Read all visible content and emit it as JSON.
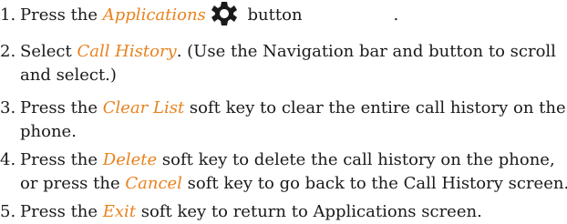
{
  "colors": {
    "text": "#1a1a1a",
    "highlight": "#e8821e"
  },
  "icons": {
    "applications_button": "gear-icon"
  },
  "steps": [
    {
      "number": "1.",
      "before": "Press the ",
      "highlight": "Applications",
      "after": " button",
      "trailing": "."
    },
    {
      "number": "2.",
      "before": "Select ",
      "highlight": "Call History",
      "after": ". (Use the Navigation bar and button to scroll",
      "continuation": "and select.)"
    },
    {
      "number": "3.",
      "before": "Press the ",
      "highlight": "Clear List",
      "after": " soft key to clear the entire call history on the",
      "continuation": "phone."
    },
    {
      "number": "4.",
      "before": "Press the ",
      "highlight": "Delete",
      "after": " soft key to delete the call history on the phone,",
      "continuation_before": "or press the ",
      "continuation_highlight": "Cancel",
      "continuation_after": " soft key to go back to the Call History screen."
    },
    {
      "number": "5.",
      "before": "Press the ",
      "highlight": "Exit",
      "after": " soft key to return to Applications screen."
    }
  ]
}
